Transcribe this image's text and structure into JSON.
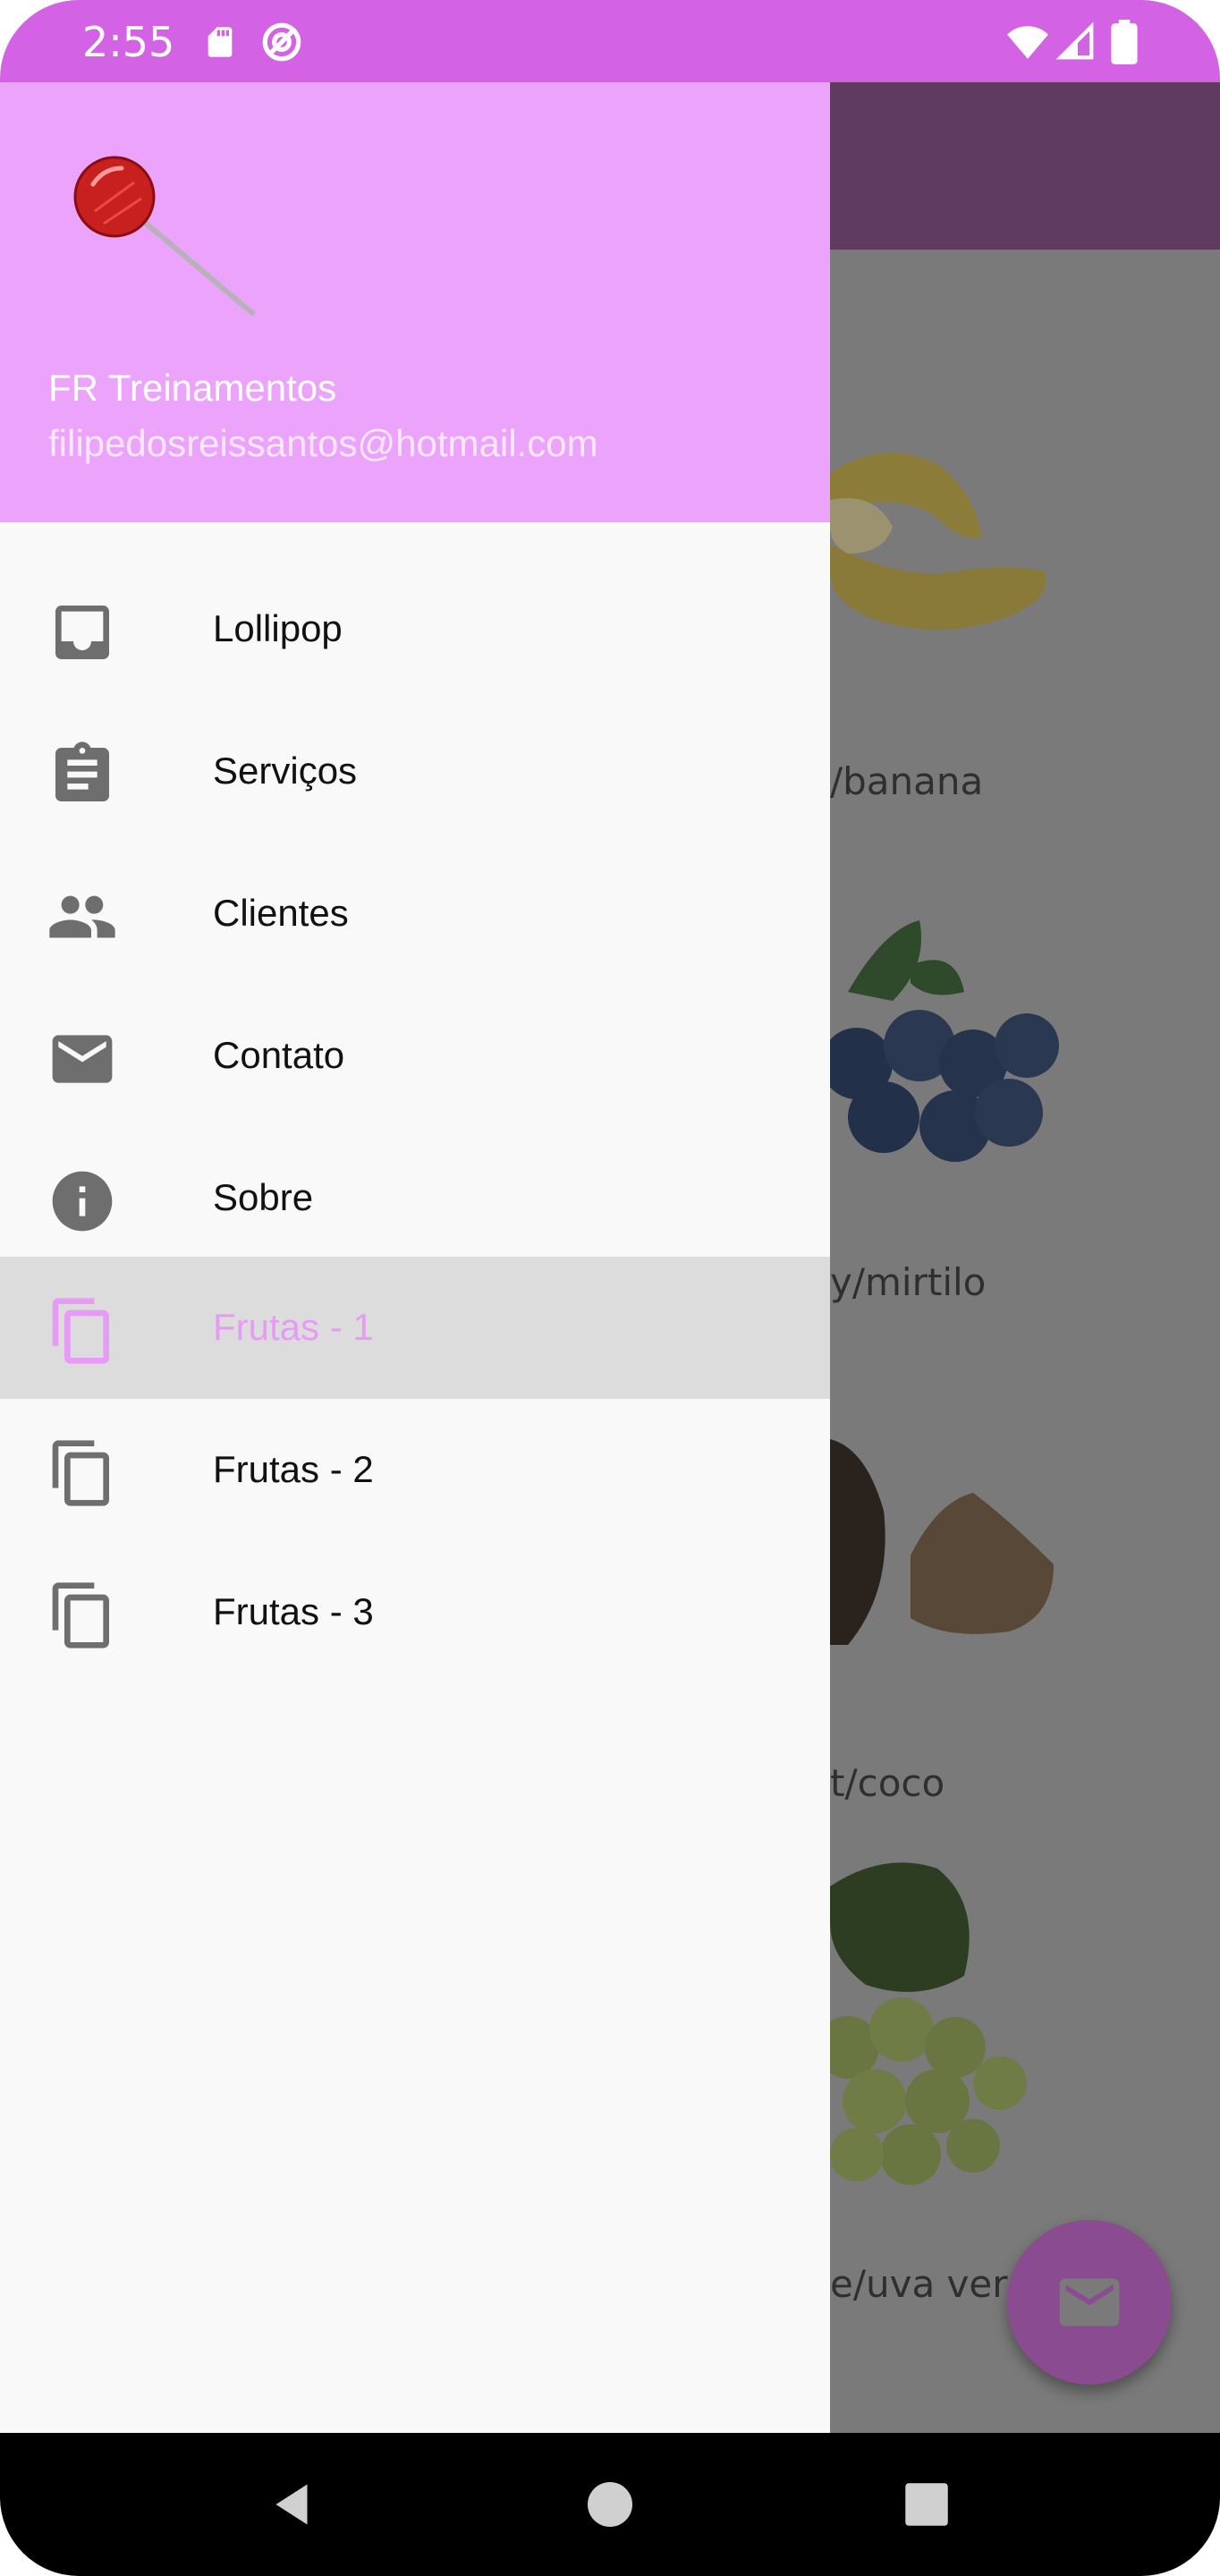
{
  "status_bar": {
    "time": "2:55",
    "icons": [
      "sd-card-icon",
      "data-saver-icon",
      "wifi-icon",
      "signal-icon",
      "battery-icon"
    ],
    "color": "#d462e4"
  },
  "drawer": {
    "header": {
      "avatar": "lollipop-icon",
      "name": "FR Treinamentos",
      "email": "filipedosreissantos@hotmail.com",
      "color": "#eba3fc"
    },
    "items": [
      {
        "label": "Lollipop",
        "icon": "inbox-icon",
        "selected": false
      },
      {
        "label": "Serviços",
        "icon": "clipboard-icon",
        "selected": false
      },
      {
        "label": "Clientes",
        "icon": "people-icon",
        "selected": false
      },
      {
        "label": "Contato",
        "icon": "mail-icon",
        "selected": false
      },
      {
        "label": "Sobre",
        "icon": "info-icon",
        "selected": false
      },
      {
        "label": "Frutas - 1",
        "icon": "copy-icon",
        "selected": true
      },
      {
        "label": "Frutas - 2",
        "icon": "copy-icon",
        "selected": false
      },
      {
        "label": "Frutas - 3",
        "icon": "copy-icon",
        "selected": false
      }
    ],
    "selected_color": "#e79bf7"
  },
  "content": {
    "fruits": [
      {
        "label": "/banana",
        "image": "banana-image"
      },
      {
        "label": "y/mirtilo",
        "image": "blueberry-image"
      },
      {
        "label": "t/coco",
        "image": "coconut-image"
      },
      {
        "label": "e/uva ver",
        "image": "grape-image"
      }
    ]
  },
  "fab": {
    "icon": "mail-icon",
    "color": "#8a4b90"
  },
  "nav_bar": {
    "icons": [
      "back-icon",
      "home-icon",
      "recents-icon"
    ]
  }
}
